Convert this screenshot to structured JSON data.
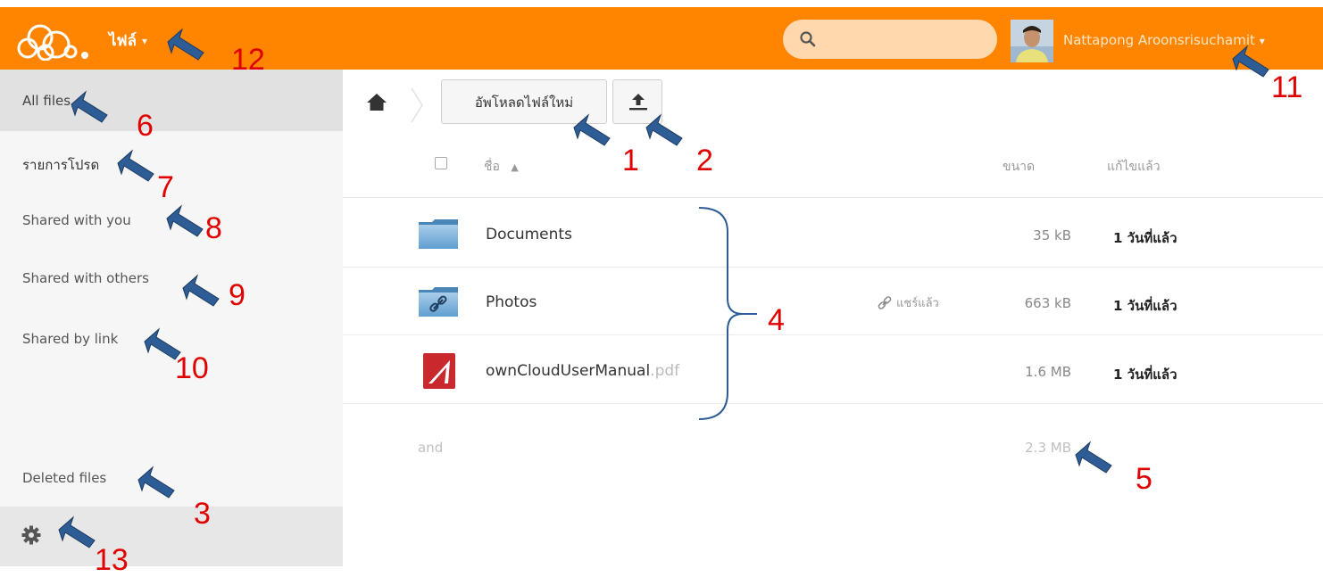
{
  "header": {
    "app_name": "ไฟล์",
    "app_caret": "▾",
    "search_placeholder": "",
    "user_name": "Nattapong Aroonsrisuchamit",
    "user_caret": "▾"
  },
  "sidebar": {
    "items": [
      {
        "label": "All files",
        "active": true
      },
      {
        "label": "รายการโปรด"
      },
      {
        "label": "Shared with you"
      },
      {
        "label": "Shared with others"
      },
      {
        "label": "Shared by link"
      },
      {
        "label": "Deleted files"
      }
    ],
    "settings_icon": "gear-icon"
  },
  "toolbar": {
    "new_label": "อัพโหลดไฟล์ใหม่",
    "upload_icon": "upload-icon"
  },
  "table": {
    "headers": {
      "name": "ชื่อ",
      "sort": "▲",
      "size": "ขนาด",
      "modified": "แก้ไขแล้ว"
    },
    "rows": [
      {
        "name": "Documents",
        "ext": "",
        "size": "35 kB",
        "modified": "1 วันที่แล้ว",
        "icon": "folder-icon",
        "shared": ""
      },
      {
        "name": "Photos",
        "ext": "",
        "size": "663 kB",
        "modified": "1 วันที่แล้ว",
        "icon": "shared-folder-icon",
        "shared": "แชร์แล้ว"
      },
      {
        "name": "ownCloudUserManual",
        "ext": ".pdf",
        "size": "1.6 MB",
        "modified": "1 วันที่แล้ว",
        "icon": "pdf-icon",
        "shared": ""
      }
    ],
    "summary": {
      "label": "and",
      "size": "2.3 MB"
    }
  },
  "annotations": [
    "1",
    "2",
    "3",
    "4",
    "5",
    "6",
    "7",
    "8",
    "9",
    "10",
    "11",
    "12",
    "13"
  ],
  "colors": {
    "header": "#ff8400",
    "annotation": "#e00000",
    "arrow": "#2e5c95"
  }
}
